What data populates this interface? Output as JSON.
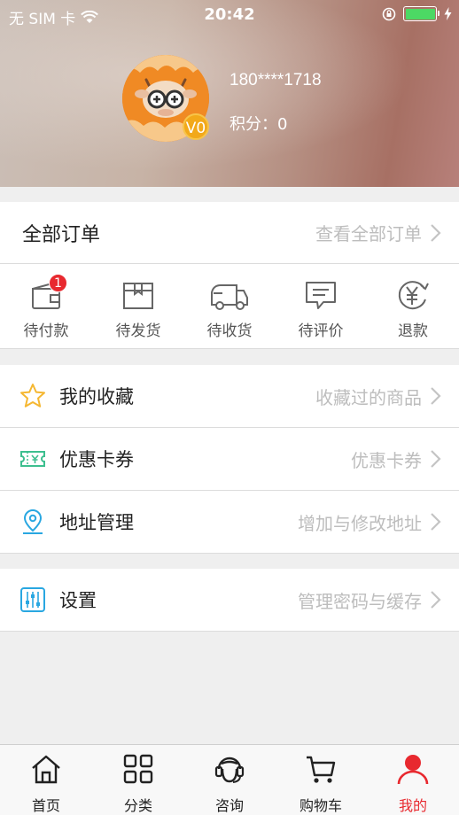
{
  "status_bar": {
    "carrier": "无 SIM 卡",
    "time": "20:42"
  },
  "profile": {
    "phone": "180****1718",
    "points_label": "积分：0",
    "level_badge": "V0"
  },
  "orders": {
    "title": "全部订单",
    "view_all": "查看全部订单",
    "statuses": [
      {
        "label": "待付款",
        "icon": "wallet-icon",
        "badge": "1"
      },
      {
        "label": "待发货",
        "icon": "package-icon"
      },
      {
        "label": "待收货",
        "icon": "truck-icon"
      },
      {
        "label": "待评价",
        "icon": "comment-icon"
      },
      {
        "label": "退款",
        "icon": "refund-yen-icon"
      }
    ]
  },
  "menu": [
    {
      "label": "我的收藏",
      "hint": "收藏过的商品",
      "icon": "star-icon"
    },
    {
      "label": "优惠卡券",
      "hint": "优惠卡券",
      "icon": "coupon-icon"
    },
    {
      "label": "地址管理",
      "hint": "增加与修改地址",
      "icon": "location-pin-icon"
    }
  ],
  "settings": {
    "label": "设置",
    "hint": "管理密码与缓存",
    "icon": "sliders-icon"
  },
  "tabbar": [
    {
      "label": "首页",
      "icon": "home-icon"
    },
    {
      "label": "分类",
      "icon": "grid-icon"
    },
    {
      "label": "咨询",
      "icon": "customer-service-icon"
    },
    {
      "label": "购物车",
      "icon": "cart-icon"
    },
    {
      "label": "我的",
      "icon": "user-icon",
      "active": true
    }
  ],
  "colors": {
    "accent_red": "#e8292f",
    "badge_gold": "#f2a91a",
    "avatar_orange": "#f08a24",
    "star_yellow": "#f5b731",
    "coupon_green": "#3dbf8f",
    "blue_icon": "#29a7e1"
  }
}
